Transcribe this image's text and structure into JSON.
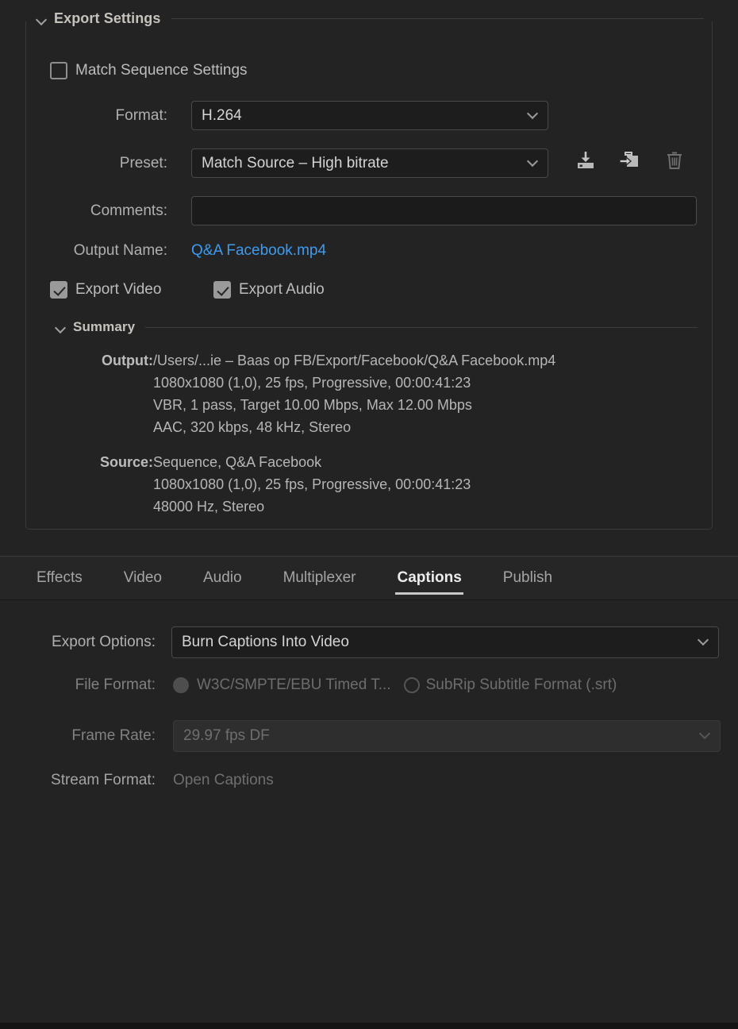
{
  "export_settings": {
    "title": "Export Settings",
    "match_sequence": {
      "label": "Match Sequence Settings",
      "checked": false
    },
    "format": {
      "label": "Format:",
      "value": "H.264"
    },
    "preset": {
      "label": "Preset:",
      "value": "Match Source – High bitrate"
    },
    "preset_actions": {
      "save": "save-preset-icon",
      "import": "import-preset-icon",
      "delete": "delete-preset-icon"
    },
    "comments": {
      "label": "Comments:",
      "value": "",
      "placeholder": ""
    },
    "output_name": {
      "label": "Output Name:",
      "value": "Q&A Facebook.mp4"
    },
    "export_video": {
      "label": "Export Video",
      "checked": true
    },
    "export_audio": {
      "label": "Export Audio",
      "checked": true
    },
    "summary": {
      "title": "Summary",
      "output_key": "Output:",
      "output_lines": [
        "/Users/...ie – Baas op FB/Export/Facebook/Q&A Facebook.mp4",
        "1080x1080 (1,0), 25 fps, Progressive, 00:00:41:23",
        "VBR, 1 pass, Target 10.00 Mbps, Max 12.00 Mbps",
        "AAC, 320 kbps, 48 kHz, Stereo"
      ],
      "source_key": "Source:",
      "source_lines": [
        "Sequence, Q&A Facebook",
        "1080x1080 (1,0), 25 fps, Progressive, 00:00:41:23",
        "48000 Hz, Stereo"
      ]
    }
  },
  "tabs": [
    {
      "label": "Effects",
      "active": false
    },
    {
      "label": "Video",
      "active": false
    },
    {
      "label": "Audio",
      "active": false
    },
    {
      "label": "Multiplexer",
      "active": false
    },
    {
      "label": "Captions",
      "active": true
    },
    {
      "label": "Publish",
      "active": false
    }
  ],
  "captions": {
    "export_options": {
      "label": "Export Options:",
      "value": "Burn Captions Into Video"
    },
    "file_format": {
      "label": "File Format:",
      "options": [
        {
          "label": "W3C/SMPTE/EBU Timed T...",
          "selected": true
        },
        {
          "label": "SubRip Subtitle Format (.srt)",
          "selected": false
        }
      ]
    },
    "frame_rate": {
      "label": "Frame Rate:",
      "value": "29.97 fps DF",
      "disabled": true
    },
    "stream_format": {
      "label": "Stream Format:",
      "value": "Open Captions",
      "disabled": true
    }
  },
  "colors": {
    "background": "#232323",
    "panel_border": "#3a3a3a",
    "link": "#3d9bf0",
    "text": "#b4b4b4",
    "disabled_text": "#6d6d6d",
    "tab_active": "#ececec"
  }
}
